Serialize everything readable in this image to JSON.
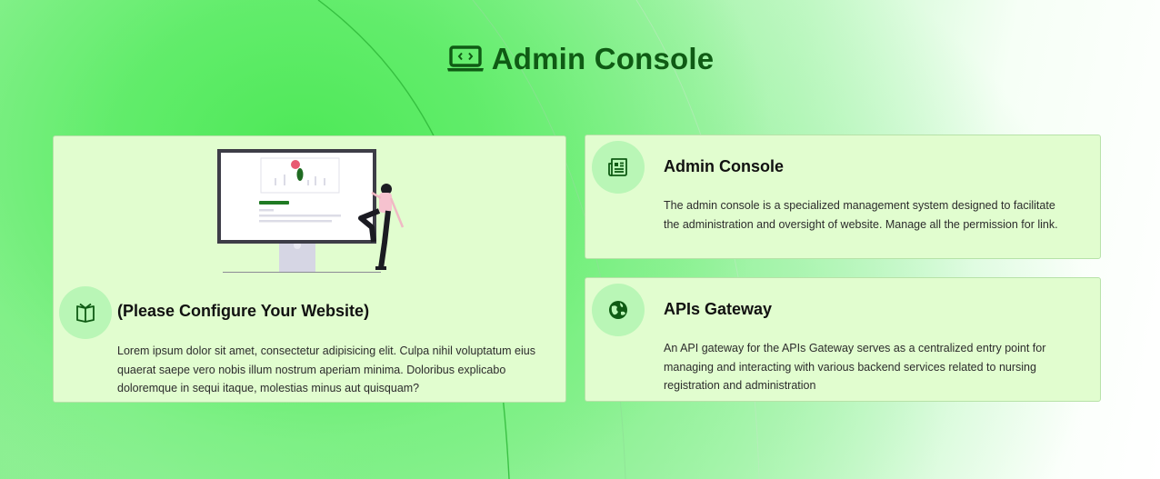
{
  "header": {
    "title": "Admin Console",
    "icon": "laptop-code-icon",
    "color": "#0f5b14"
  },
  "feature_card": {
    "title": "(Please Configure Your Website)",
    "description": "Lorem ipsum dolor sit amet, consectetur adipisicing elit. Culpa nihil voluptatum eius quaerat saepe vero nobis illum nostrum aperiam minima. Doloribus explicabo doloremque in sequi itaque, molestias minus aut quisquam?",
    "icon": "book-open-icon",
    "illustration": "person-with-monitor-illustration"
  },
  "cards": [
    {
      "title": "Admin Console",
      "description": "The admin console is a specialized management system designed to facilitate the administration and oversight of website. Manage all the permission for link.",
      "icon": "newspaper-icon"
    },
    {
      "title": "APIs Gateway",
      "description": "An API gateway for the APIs Gateway serves as a centralized entry point for managing and interacting with various backend services related to nursing registration and administration",
      "icon": "globe-network-icon"
    }
  ],
  "colors": {
    "accent": "#0f5b14",
    "card_bg": "#e1fdcf",
    "icon_circle": "#b9f6b6"
  }
}
